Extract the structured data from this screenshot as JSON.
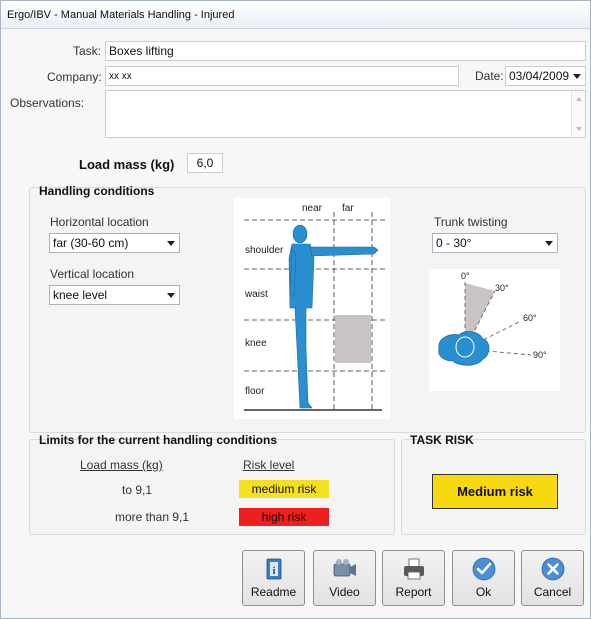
{
  "window": {
    "title": "Ergo/IBV - Manual Materials Handling - Injured"
  },
  "form": {
    "task_label": "Task:",
    "task_value": "Boxes lifting",
    "company_label": "Company:",
    "company_value": "xx xx",
    "date_label": "Date:",
    "date_value": "03/04/2009",
    "observations_label": "Observations:",
    "observations_value": ""
  },
  "load": {
    "label": "Load mass (kg)",
    "value": "6,0"
  },
  "handling": {
    "title": "Handling conditions",
    "horizontal_label": "Horizontal location",
    "horizontal_value": "far (30-60 cm)",
    "vertical_label": "Vertical location",
    "vertical_value": "knee level",
    "trunk_label": "Trunk twisting",
    "trunk_value": "0 - 30°",
    "figure": {
      "near": "near",
      "far": "far",
      "shoulder": "shoulder",
      "waist": "waist",
      "knee": "knee",
      "floor": "floor"
    },
    "twist_angles": [
      "0°",
      "30°",
      "60°",
      "90°"
    ]
  },
  "limits": {
    "title": "Limits for the current handling conditions",
    "col_mass": "Load mass (kg)",
    "col_risk": "Risk level",
    "rows": [
      {
        "mass": "to 9,1",
        "risk": "medium risk",
        "color": "#f5e020"
      },
      {
        "mass": "more than 9,1",
        "risk": "high risk",
        "color": "#ef1f1f"
      }
    ]
  },
  "task_risk": {
    "title": "TASK RISK",
    "value": "Medium risk",
    "color": "#f8d90f"
  },
  "buttons": {
    "readme": "Readme",
    "video": "Video",
    "report": "Report",
    "ok": "Ok",
    "cancel": "Cancel"
  }
}
